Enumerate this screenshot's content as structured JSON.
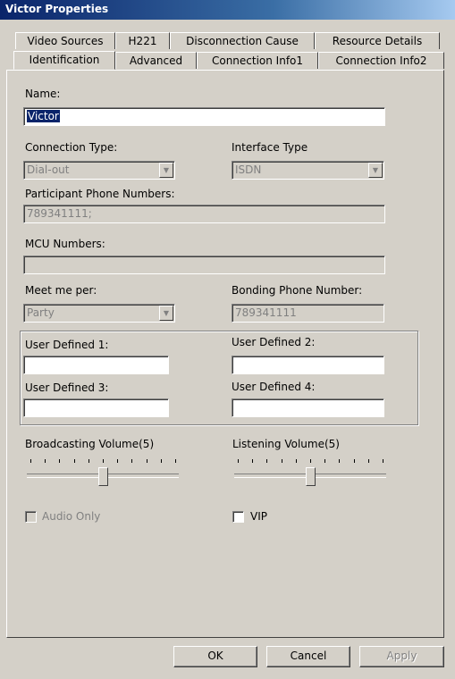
{
  "window": {
    "title": "Victor Properties"
  },
  "tabs_back": [
    "Video Sources",
    "H221",
    "Disconnection Cause",
    "Resource Details"
  ],
  "tabs_front": [
    "Identification",
    "Advanced",
    "Connection Info1",
    "Connection Info2"
  ],
  "active_tab": "Identification",
  "form": {
    "name_label": "Name:",
    "name_value": "Victor",
    "connection_type_label": "Connection Type:",
    "connection_type_value": "Dial-out",
    "interface_type_label": "Interface Type",
    "interface_type_value": "ISDN",
    "participant_phones_label": "Participant Phone Numbers:",
    "participant_phones_value": "789341111;",
    "mcu_numbers_label": "MCU Numbers:",
    "mcu_numbers_value": "",
    "meet_me_label": "Meet me per:",
    "meet_me_value": "Party",
    "bonding_phone_label": "Bonding Phone Number:",
    "bonding_phone_value": "789341111",
    "user_defined_1_label": "User Defined 1:",
    "user_defined_2_label": "User Defined 2:",
    "user_defined_3_label": "User Defined 3:",
    "user_defined_4_label": "User Defined 4:",
    "broadcasting_volume_label": "Broadcasting Volume(5)",
    "broadcasting_volume_value": 5,
    "listening_volume_label": "Listening Volume(5)",
    "listening_volume_value": 5,
    "audio_only_label": "Audio Only",
    "audio_only_checked": false,
    "vip_label": "VIP",
    "vip_checked": false
  },
  "buttons": {
    "ok": "OK",
    "cancel": "Cancel",
    "apply": "Apply"
  }
}
